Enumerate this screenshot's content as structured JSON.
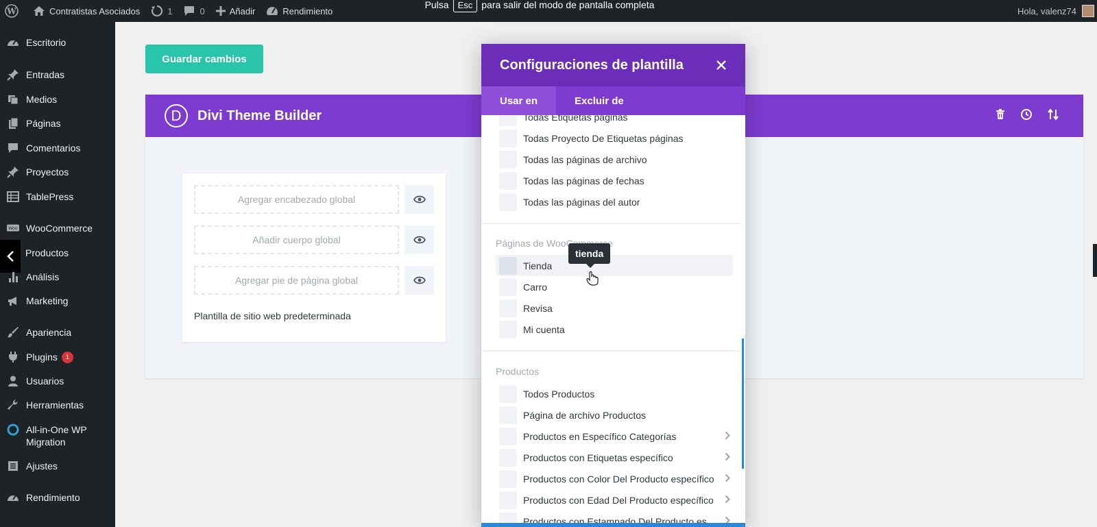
{
  "adminbar": {
    "site_name": "Contratistas Asociados",
    "updates_count": "1",
    "comments_count": "0",
    "new_label": "Añadir",
    "performance_label": "Rendimiento",
    "fullscreen_notice_before": "Pulsa",
    "fullscreen_notice_key": "Esc",
    "fullscreen_notice_after": "para salir del modo de pantalla completa",
    "greeting": "Hola, valenz74"
  },
  "sidebar": {
    "items": [
      {
        "label": "Escritorio",
        "icon": "dashboard-icon"
      },
      {
        "label": "Entradas",
        "icon": "pin-icon"
      },
      {
        "label": "Medios",
        "icon": "media-icon"
      },
      {
        "label": "Páginas",
        "icon": "pages-icon"
      },
      {
        "label": "Comentarios",
        "icon": "comments-icon"
      },
      {
        "label": "Proyectos",
        "icon": "pin-icon"
      },
      {
        "label": "TablePress",
        "icon": "table-icon"
      },
      {
        "label": "WooCommerce",
        "icon": "woo-icon"
      },
      {
        "label": "Productos",
        "icon": "products-icon"
      },
      {
        "label": "Análisis",
        "icon": "chart-icon"
      },
      {
        "label": "Marketing",
        "icon": "megaphone-icon"
      },
      {
        "label": "Apariencia",
        "icon": "brush-icon"
      },
      {
        "label": "Plugins",
        "icon": "plugin-icon",
        "badge": "1"
      },
      {
        "label": "Usuarios",
        "icon": "user-icon"
      },
      {
        "label": "Herramientas",
        "icon": "wrench-icon"
      },
      {
        "label": "All-in-One WP",
        "label2": "Migration",
        "icon": "migration-icon"
      },
      {
        "label": "Ajustes",
        "icon": "settings-icon"
      },
      {
        "label": "Rendimiento",
        "icon": "performance-icon"
      }
    ]
  },
  "main": {
    "save_label": "Guardar cambios",
    "builder_title": "Divi Theme Builder",
    "logo_letter": "D",
    "slots": [
      "Agregar encabezado global",
      "Añadir cuerpo global",
      "Agregar pie de página global"
    ],
    "template_name": "Plantilla de sitio web predeterminada"
  },
  "modal": {
    "title": "Configuraciones de plantilla",
    "tabs": [
      "Usar en",
      "Excluir de"
    ],
    "archive_items": [
      "Todas Etiquetas páginas",
      "Todas Proyecto De Etiquetas páginas",
      "Todas las páginas de archivo",
      "Todas las páginas de fechas",
      "Todas las páginas del autor"
    ],
    "woo_section": "Páginas de WooCommerce",
    "woo_items": [
      "Tienda",
      "Carro",
      "Revisa",
      "Mi cuenta"
    ],
    "products_section": "Productos",
    "product_items": [
      "Todos Productos",
      "Página de archivo Productos",
      "Productos en Específico Categorías",
      "Productos con Etiquetas específico",
      "Productos con Color Del Producto específico",
      "Productos con Edad Del Producto específico",
      "Productos con Estampado Del Producto específico"
    ],
    "tooltip": "tienda"
  },
  "colors": {
    "accent_purple": "#7e3bd0",
    "modal_header": "#6c2eb9",
    "save_green": "#29c4a9",
    "admin_dark": "#1d2327"
  }
}
